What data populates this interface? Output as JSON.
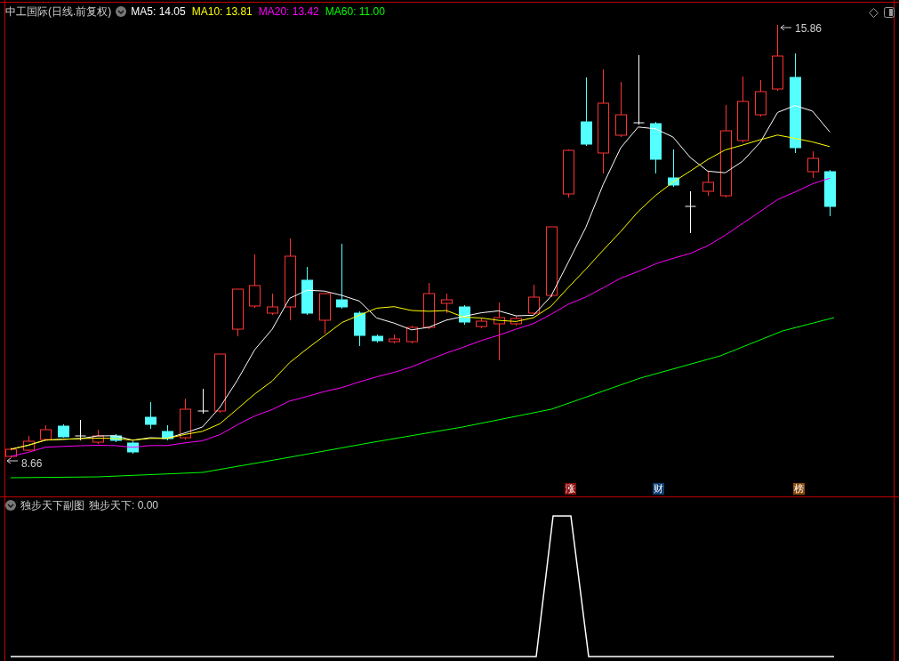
{
  "main_chart": {
    "title": "中工国际(日线.前复权)",
    "moving_averages": [
      {
        "label": "MA5: 14.05",
        "color": "#ffffff"
      },
      {
        "label": "MA10: 13.81",
        "color": "#ffff00"
      },
      {
        "label": "MA20: 13.42",
        "color": "#ff00ff"
      },
      {
        "label": "MA60: 11.00",
        "color": "#00ff00"
      }
    ],
    "high_label": "15.86",
    "low_label": "8.66",
    "event_markers": [
      {
        "label": "涨",
        "color": "#8b0a0a"
      },
      {
        "label": "财",
        "color": "#0f3d73"
      },
      {
        "label": "榜",
        "color": "#8a4a0c"
      }
    ]
  },
  "sub_chart": {
    "title": "独步天下副图",
    "reading": "独步天下: 0.00"
  }
}
